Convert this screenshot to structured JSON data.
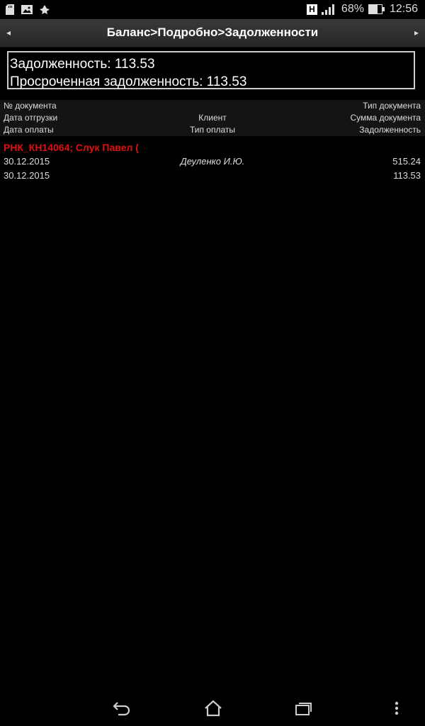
{
  "status_bar": {
    "h_indicator": "H",
    "battery_percent": "68%",
    "battery_level": 0.68,
    "time": "12:56"
  },
  "title_bar": {
    "title": "Баланс>Подробно>Задолженности",
    "left_arrow": "◂",
    "right_arrow": "▸"
  },
  "summary": {
    "debt": "Задолженность: 113.53",
    "overdue_debt": "Просроченная задолженность: 113.53"
  },
  "column_headers": {
    "row1": {
      "left": "№ документа",
      "center": "",
      "right": "Тип документа"
    },
    "row2": {
      "left": "Дата отгрузки",
      "center": "Клиент",
      "right": "Сумма документа"
    },
    "row3": {
      "left": "Дата оплаты",
      "center": "Тип оплаты",
      "right": "Задолженность"
    }
  },
  "documents": [
    {
      "title": "РНК_КН14064; Слук Павел (",
      "row1": {
        "left": "30.12.2015",
        "center": "Деуленко И.Ю.",
        "right": "515.24"
      },
      "row2": {
        "left": "30.12.2015",
        "center": "",
        "right": "113.53"
      }
    }
  ],
  "colors": {
    "background": "#000000",
    "document_title": "#e01010",
    "text": "#dddddd"
  },
  "icons": {
    "back": "back-icon",
    "home": "home-icon",
    "recents": "recents-icon",
    "menu": "overflow-menu-icon"
  }
}
